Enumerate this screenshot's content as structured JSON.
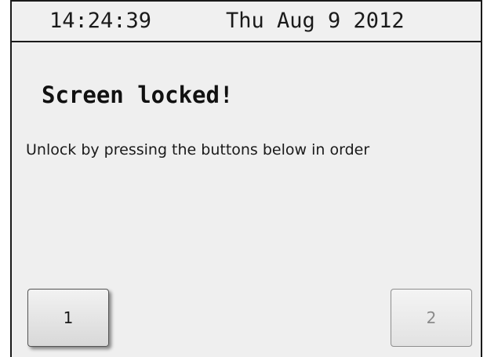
{
  "status_bar": {
    "time": "14:24:39",
    "date": "Thu Aug 9 2012"
  },
  "lock_screen": {
    "title": "Screen locked!",
    "instructions": "Unlock by pressing the buttons below in order",
    "buttons": [
      {
        "label": "1",
        "state": "active"
      },
      {
        "label": "2",
        "state": "inactive"
      }
    ]
  }
}
